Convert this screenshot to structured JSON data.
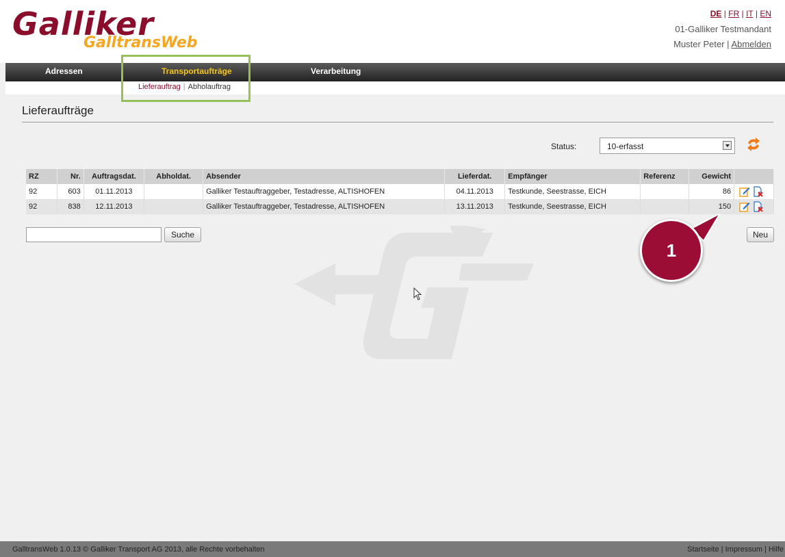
{
  "header": {
    "logo_text": "Galliker",
    "logo_subtext": "GalltransWeb",
    "languages": [
      "DE",
      "FR",
      "IT",
      "EN"
    ],
    "lang_sep": "|",
    "mandant": "01-Galliker Testmandant",
    "user": "Muster Peter",
    "user_sep": "|",
    "logout": "Abmelden"
  },
  "nav": {
    "items": [
      {
        "label": "Adressen"
      },
      {
        "label": "Transportaufträge",
        "active": true
      },
      {
        "label": "Verarbeitung"
      }
    ],
    "sub_items": [
      {
        "label": "Lieferauftrag",
        "active": true
      },
      {
        "label": "Abholauftrag"
      }
    ],
    "sub_sep": "|"
  },
  "page": {
    "title": "Lieferaufträge",
    "status_label": "Status:",
    "status_value": "10-erfasst"
  },
  "table": {
    "columns": [
      "RZ",
      "Nr.",
      "Auftragsdat.",
      "Abholdat.",
      "Absender",
      "Lieferdat.",
      "Empfänger",
      "Referenz",
      "Gewicht"
    ],
    "rows": [
      {
        "rz": "92",
        "nr": "603",
        "auftragsdat": "01.11.2013",
        "abholdat": "",
        "absender": "Galliker Testauftraggeber, Testadresse, ALTISHOFEN",
        "lieferdat": "04.11.2013",
        "empfaenger": "Testkunde, Seestrasse, EICH",
        "referenz": "",
        "gewicht": "86"
      },
      {
        "rz": "92",
        "nr": "838",
        "auftragsdat": "12.11.2013",
        "abholdat": "",
        "absender": "Galliker Testauftraggeber, Testadresse, ALTISHOFEN",
        "lieferdat": "13.11.2013",
        "empfaenger": "Testkunde, Seestrasse, EICH",
        "referenz": "",
        "gewicht": "150"
      }
    ]
  },
  "search": {
    "value": "",
    "button_label": "Suche"
  },
  "new_button_label": "Neu",
  "callout_number": "1",
  "footer": {
    "copyright": "GalltransWeb 1.0.13 © Galliker Transport AG 2013, alle Rechte vorbehalten",
    "links": [
      "Startseite",
      "Impressum",
      "Hilfe"
    ],
    "link_sep": "|"
  },
  "colors": {
    "brand": "#8b0d2c",
    "accent": "#f5a623",
    "callout": "#9b0d35",
    "highlight": "#96c058"
  },
  "icons": [
    "refresh-icon",
    "edit-icon",
    "delete-icon",
    "mouse-cursor-icon",
    "galliker-watermark-icon"
  ]
}
